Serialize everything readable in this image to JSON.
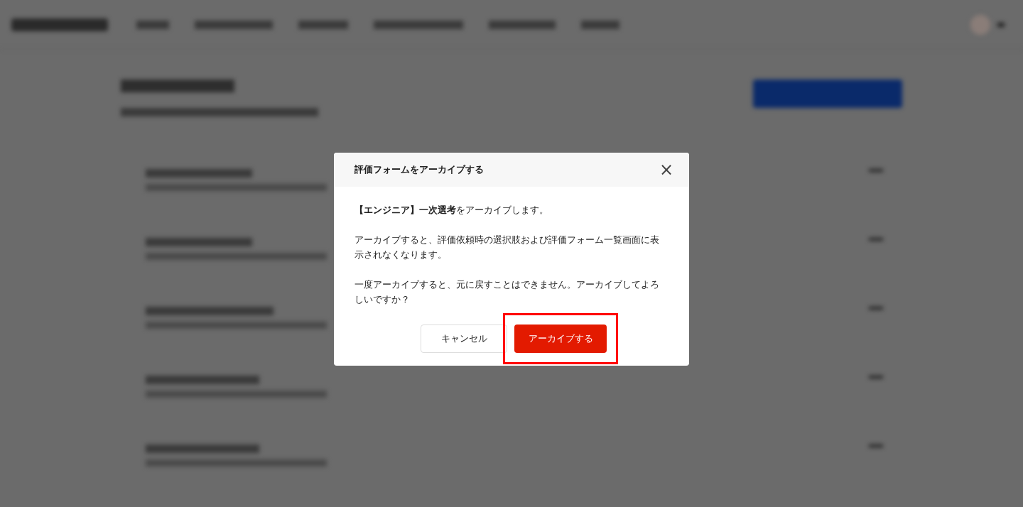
{
  "dialog": {
    "title": "評価フォームをアーカイブする",
    "paragraphs": [
      "**【エンジニア】一次選考**をアーカイブします。",
      "アーカイブすると、評価依頼時の選択肢および評価フォーム一覧画面に表示されなくなります。",
      "一度アーカイブすると、元に戻すことはできません。アーカイブしてよろしいですか？"
    ],
    "close_icon": "×",
    "buttons": [
      {
        "label": "キャンセル",
        "kind": "secondary",
        "highlighted": false
      },
      {
        "label": "アーカイブする",
        "kind": "danger",
        "highlighted": true
      }
    ]
  }
}
